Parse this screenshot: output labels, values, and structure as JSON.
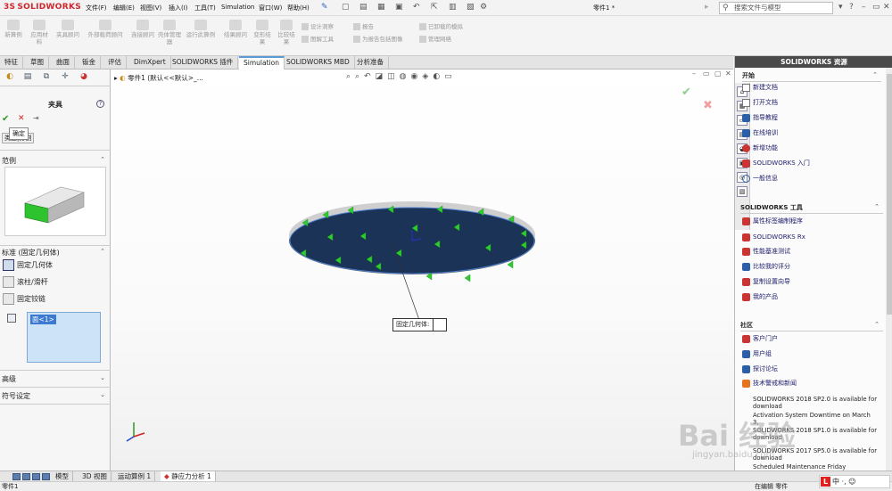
{
  "app": {
    "logo_text": "SOLIDWORKS",
    "logo_mark": "3S",
    "document_title": "零件1 *",
    "search_placeholder": "搜索文件与模型",
    "menus": [
      "文件(F)",
      "编辑(E)",
      "视图(V)",
      "插入(I)",
      "工具(T)",
      "Simulation",
      "窗口(W)",
      "帮助(H)"
    ]
  },
  "command_manager": {
    "buttons": [
      {
        "label": "新算例"
      },
      {
        "label": "应用材料"
      },
      {
        "label": "夹具顾问"
      },
      {
        "label": "外部载荷顾问"
      },
      {
        "label": "连接顾问"
      },
      {
        "label": "壳体管理器"
      },
      {
        "label": "运行此算例"
      },
      {
        "label": "结果顾问"
      },
      {
        "label": "变形结果"
      },
      {
        "label": "比较结果"
      }
    ],
    "rows": [
      "设计洞察",
      "图解工具",
      "报告",
      "为报告包括图像",
      "已卸载的模拟",
      "管理网络"
    ]
  },
  "tabs": [
    "特征",
    "草图",
    "曲面",
    "钣金",
    "评估",
    "DimXpert",
    "SOLIDWORKS 插件",
    "Simulation",
    "SOLIDWORKS MBD",
    "分析准备"
  ],
  "active_tab": "Simulation",
  "property_manager": {
    "title": "夹具",
    "tooltip": "确定",
    "subtab": "类型",
    "subtab2": "分割",
    "sections": {
      "example": "范例",
      "standard": "标准 (固定几何体)",
      "advanced": "高级",
      "symbols": "符号设定"
    },
    "options": [
      "固定几何体",
      "滚柱/滑杆",
      "固定铰链"
    ],
    "selected_option": "固定几何体",
    "selection_list": [
      "面<1>"
    ]
  },
  "viewport": {
    "tree_root": "零件1 (默认<<默认>_...",
    "callout_label": "固定几何体:"
  },
  "task_pane": {
    "title": "SOLIDWORKS 资源",
    "groups": [
      {
        "name": "开始",
        "links": [
          "新建文档",
          "打开文档",
          "指导教程",
          "在线培训",
          "新增功能",
          "SOLIDWORKS 入门",
          "一般信息"
        ]
      },
      {
        "name": "SOLIDWORKS 工具",
        "links": [
          "属性标签编制程序",
          "SOLIDWORKS Rx",
          "性能基准测试",
          "比较我的评分",
          "复制设置向导",
          "我的产品"
        ]
      },
      {
        "name": "社区",
        "links": [
          "客户门户",
          "用户组",
          "探讨论坛",
          "技术警戒和新闻"
        ]
      }
    ],
    "news": [
      "SOLIDWORKS 2018 SP2.0 is available for download",
      "Activation System Downtime on March 3,",
      "SOLIDWORKS 2018 SP1.0 is available for download",
      "SOLIDWORKS 2017 SP5.0 is available for download",
      "Scheduled Maintenance Friday"
    ]
  },
  "bottom_tabs": [
    "模型",
    "3D 视图",
    "运动算例 1",
    "静应力分析 1"
  ],
  "active_bottom_tab": "静应力分析 1",
  "status": {
    "left": "零件1",
    "right": "在编辑 零件"
  },
  "overlay": {
    "watermark": "Bai 经验",
    "watermark_url": "jingyan.baidu.com",
    "ime": "中 ·, ☺"
  }
}
